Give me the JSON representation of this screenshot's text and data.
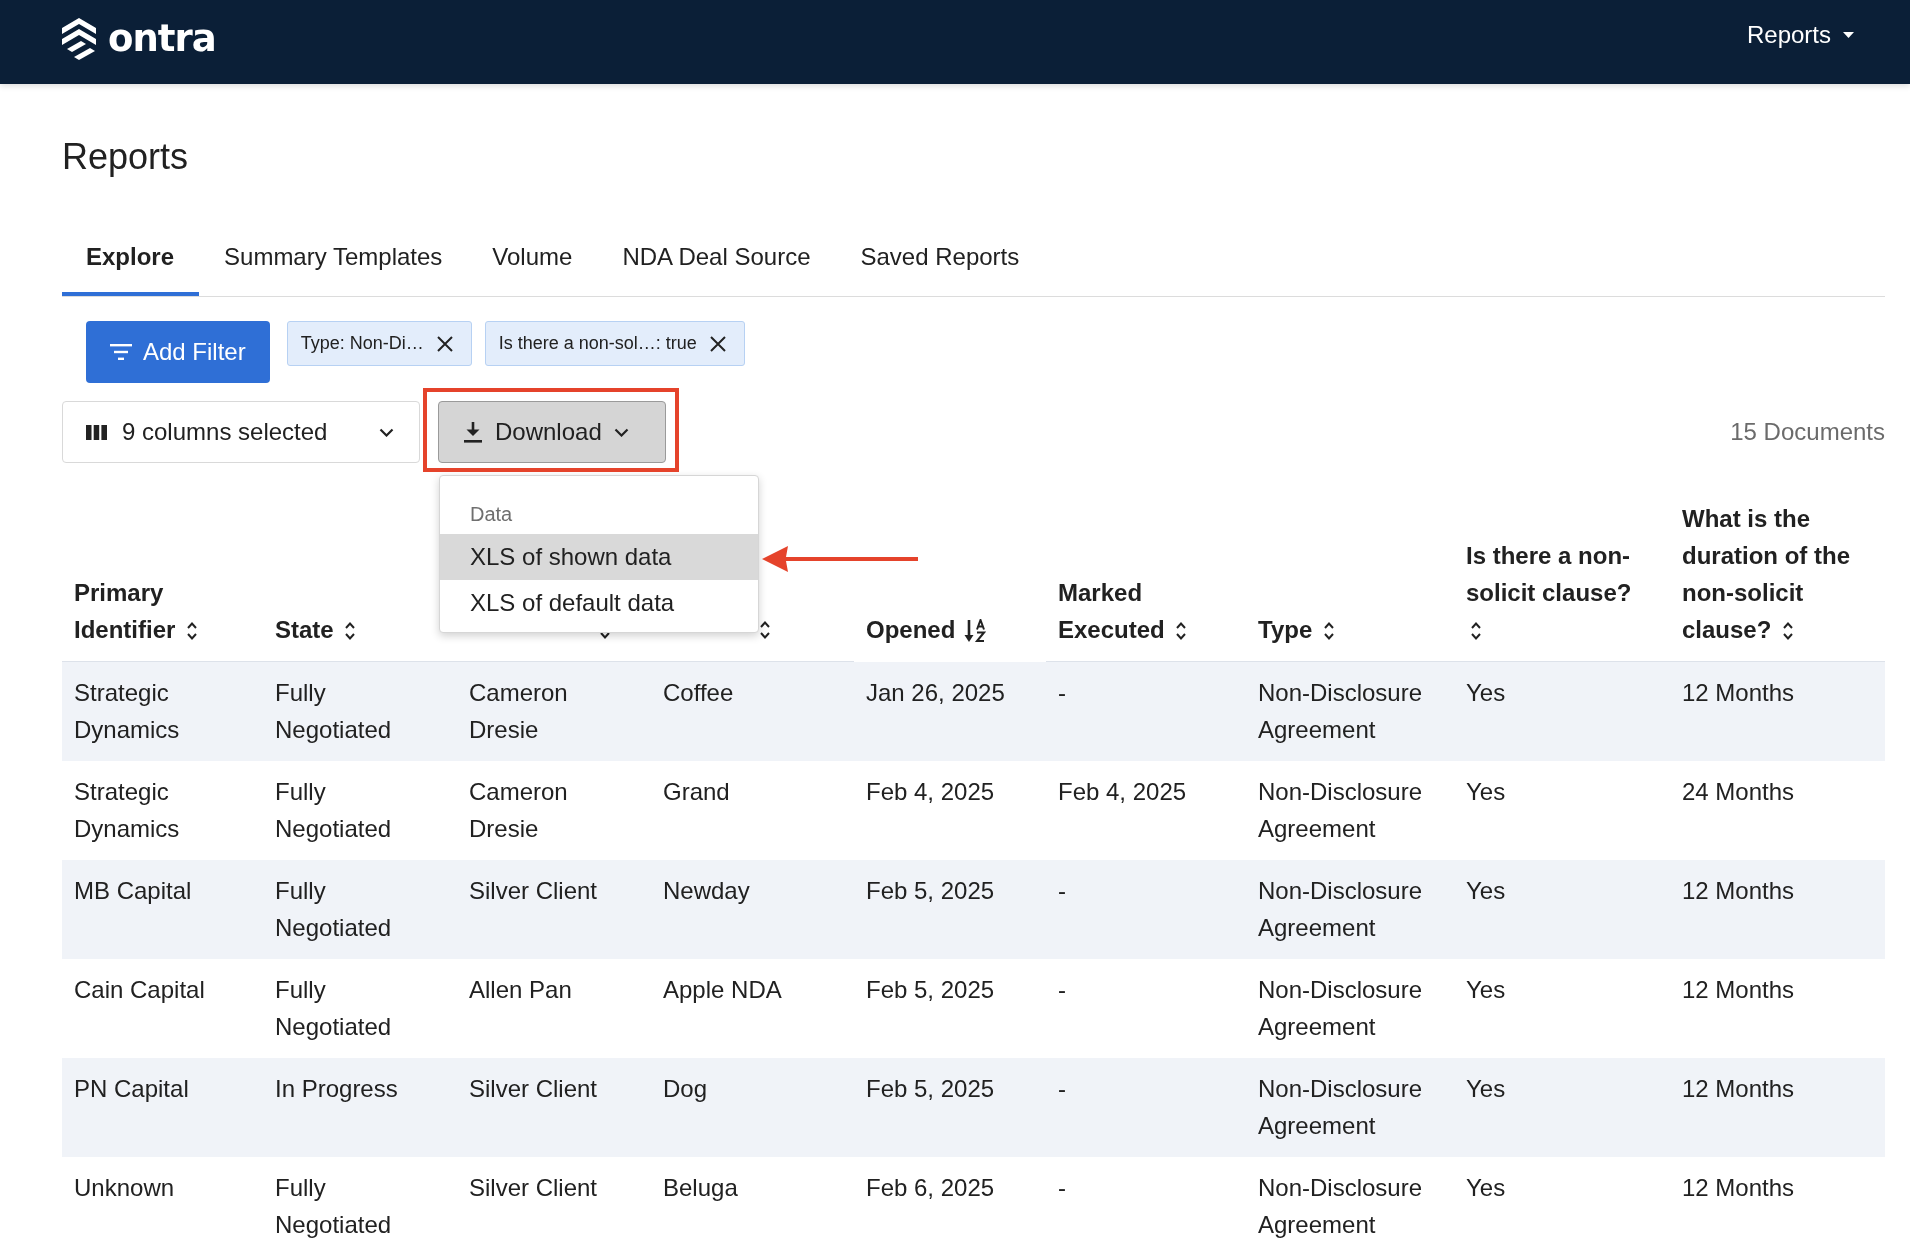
{
  "top_bar": {
    "logo": "ontra",
    "menu": "Reports"
  },
  "page_title": "Reports",
  "tabs": [
    {
      "label": "Explore",
      "selected": true
    },
    {
      "label": "Summary Templates",
      "selected": false
    },
    {
      "label": "Volume",
      "selected": false
    },
    {
      "label": "NDA Deal Source",
      "selected": false
    },
    {
      "label": "Saved Reports",
      "selected": false
    }
  ],
  "add_filter_button": "Add Filter",
  "filters": [
    {
      "label": "Type: Non-Di…"
    },
    {
      "label": "Is there a non-sol…: true"
    }
  ],
  "columns_selector": "9 columns selected",
  "download_button": {
    "label": "Download",
    "expanded": true,
    "highlighted": true
  },
  "document_count": "15 Documents",
  "download_menu": {
    "section": "Data",
    "items": [
      {
        "label": "XLS of shown data",
        "selected": true,
        "callout": true
      },
      {
        "label": "XLS of default data",
        "selected": false,
        "callout": false
      }
    ]
  },
  "table": {
    "columns": [
      {
        "label": "Primary Identifier",
        "sorted": false
      },
      {
        "label": "State",
        "sorted": false
      },
      {
        "sorted": false
      },
      {
        "sorted": false
      },
      {
        "label": "Opened",
        "sorted": true
      },
      {
        "label": "Marked Executed",
        "sorted": false
      },
      {
        "label": "Type",
        "sorted": false
      },
      {
        "label": "Is there a non-solicit clause?",
        "sorted": false
      },
      {
        "label": "What is the duration of the non-solicit clause?",
        "sorted": false
      }
    ],
    "rows": [
      {
        "cells": [
          "Strategic Dynamics",
          "Fully Negotiated",
          "Cameron Dresie",
          "Coffee",
          "Jan 26, 2025",
          "-",
          "Non-Disclosure Agreement",
          "Yes",
          "12 Months"
        ]
      },
      {
        "cells": [
          "Strategic Dynamics",
          "Fully Negotiated",
          "Cameron Dresie",
          "Grand",
          "Feb 4, 2025",
          "Feb 4, 2025",
          "Non-Disclosure Agreement",
          "Yes",
          "24 Months"
        ]
      },
      {
        "cells": [
          "MB Capital",
          "Fully Negotiated",
          "Silver Client",
          "Newday",
          "Feb 5, 2025",
          "-",
          "Non-Disclosure Agreement",
          "Yes",
          "12 Months"
        ]
      },
      {
        "cells": [
          "Cain Capital",
          "Fully Negotiated",
          "Allen Pan",
          "Apple NDA",
          "Feb 5, 2025",
          "-",
          "Non-Disclosure Agreement",
          "Yes",
          "12 Months"
        ]
      },
      {
        "cells": [
          "PN Capital",
          "In Progress",
          "Silver Client",
          "Dog",
          "Feb 5, 2025",
          "-",
          "Non-Disclosure Agreement",
          "Yes",
          "12 Months"
        ]
      },
      {
        "cells": [
          "Unknown",
          "Fully Negotiated",
          "Silver Client",
          "Beluga",
          "Feb 6, 2025",
          "-",
          "Non-Disclosure Agreement",
          "Yes",
          "12 Months"
        ]
      }
    ]
  }
}
